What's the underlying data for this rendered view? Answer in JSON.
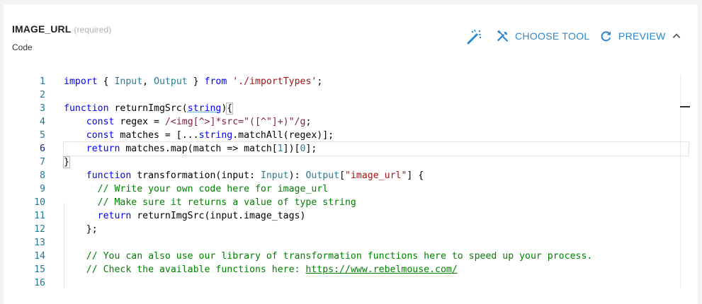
{
  "field": {
    "name": "IMAGE_URL",
    "required_hint": "(required)",
    "type": "Code"
  },
  "toolbar": {
    "wand_icon": "magic-wand-icon",
    "choose_tool_label": "CHOOSE TOOL",
    "preview_label": "PREVIEW",
    "accent_color": "#2f86c8"
  },
  "editor": {
    "line_numbers": [
      "1",
      "2",
      "3",
      "4",
      "5",
      "6",
      "7",
      "8",
      "9",
      "10",
      "11",
      "12",
      "13",
      "14",
      "15",
      "16"
    ],
    "active_line": 6,
    "lines": [
      "import { Input, Output } from './importTypes';",
      "",
      "function returnImgSrc(string){",
      "    const regex = /<img[^>]*src=\"([^\"]+)\"/g;",
      "    const matches = [...string.matchAll(regex)];",
      "    return matches.map(match => match[1])[0];",
      "}",
      "    function transformation(input: Input): Output[\"image_url\"] {",
      "      // Write your own code here for image_url",
      "      // Make sure it returns a value of type string",
      "      return returnImgSrc(input.image_tags)",
      "    };",
      "",
      "    // You can also use our library of transformation functions here to speed up your process.",
      "    // Check the available functions here: https://www.rebelmouse.com/",
      ""
    ],
    "link": "https://www.rebelmouse.com/"
  }
}
